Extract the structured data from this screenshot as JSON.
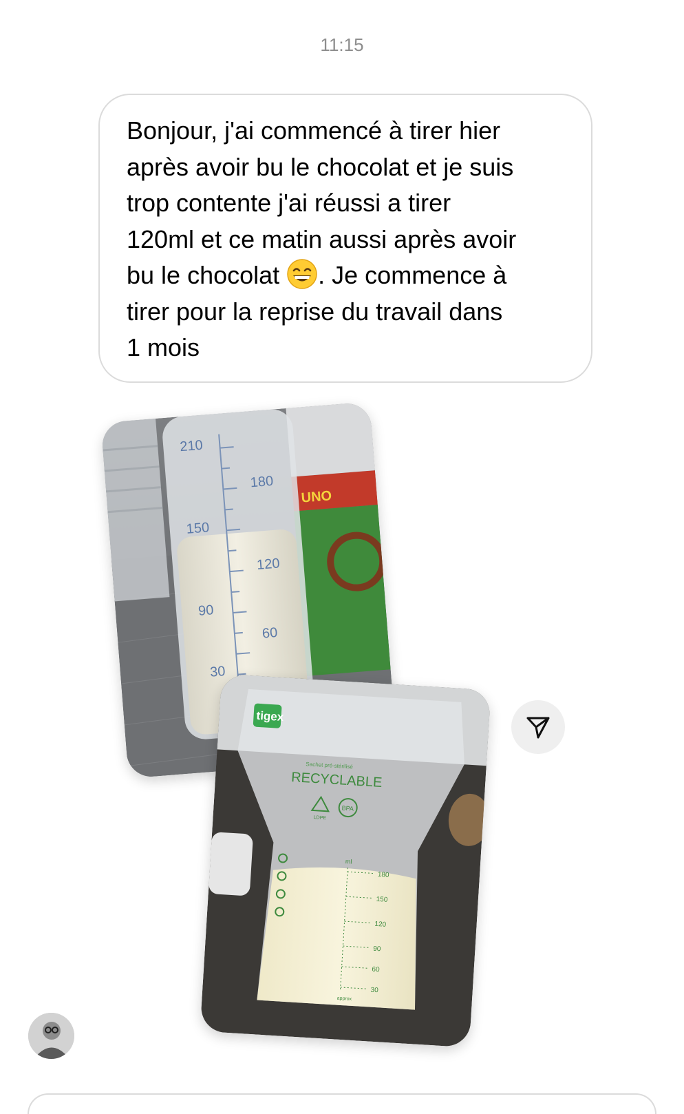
{
  "conversation": {
    "timestamp": "11:15",
    "message": {
      "text_before_emoji": "Bonjour, j'ai commencé à tirer hier\naprès avoir bu le chocolat et je suis\ntrop contente j'ai réussi a tirer\n120ml et ce matin aussi après avoir\nbu le chocolat ",
      "emoji": "grinning-face-with-smiling-eyes",
      "text_after_emoji": ". Je commence à\ntirer pour la reprise du travail dans\n1 mois"
    },
    "photo_1": {
      "bottle_scale_labels": [
        "210",
        "180",
        "150",
        "120",
        "90",
        "60",
        "30"
      ],
      "background_box_text": "UNO"
    },
    "photo_2": {
      "bag_brand": "tigex",
      "bag_caption_small": "Sachet pré-stérilisé",
      "bag_label": "RECYCLABLE",
      "bag_recycle_text": "LDPE",
      "bag_bpa_text": "BPA",
      "bag_unit": "ml",
      "bag_scale_labels": [
        "180",
        "150",
        "120",
        "90",
        "60",
        "30"
      ],
      "bag_footer": "approx"
    },
    "share_icon": "send-paper-plane-icon",
    "avatar_icon": "user-avatar"
  }
}
